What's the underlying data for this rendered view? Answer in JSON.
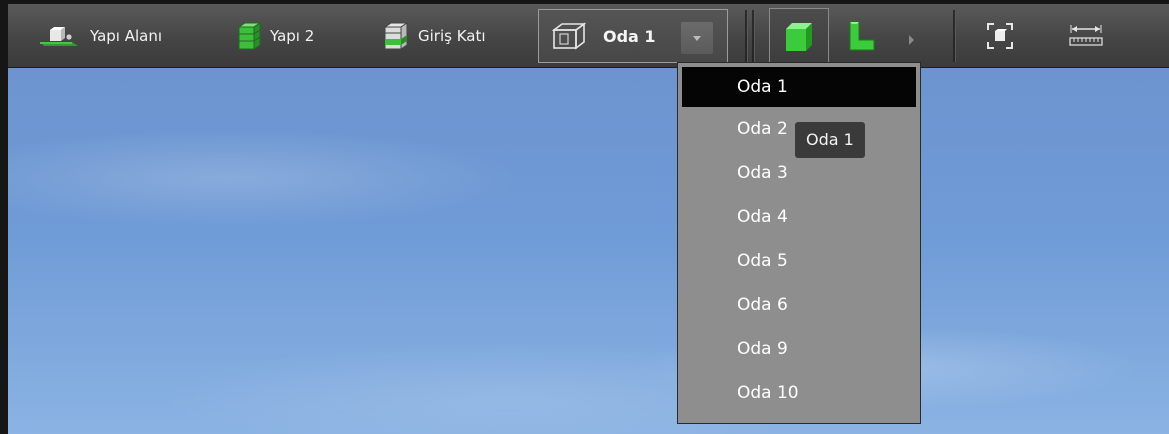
{
  "toolbar": {
    "items": [
      {
        "label": "Yapı Alanı",
        "icon": "site-box-icon"
      },
      {
        "label": "Yapı 2",
        "icon": "building-icon"
      },
      {
        "label": "Giriş Katı",
        "icon": "floor-icon"
      }
    ],
    "room_selector": {
      "value": "Oda 1",
      "icon": "room-icon"
    },
    "tools": [
      {
        "icon": "solid-view-icon"
      },
      {
        "icon": "wall-l-shape-icon"
      },
      {
        "icon": "more-arrow-icon"
      },
      {
        "icon": "fit-view-icon"
      },
      {
        "icon": "measure-ruler-icon"
      }
    ]
  },
  "dropdown": {
    "options": [
      "Oda 1",
      "Oda 2",
      "Oda 3",
      "Oda 4",
      "Oda 5",
      "Oda 6",
      "Oda 9",
      "Oda 10"
    ],
    "selected_index": 0
  },
  "tooltip": {
    "text": "Oda 1"
  },
  "colors": {
    "toolbar_bg": "#4a4a4a",
    "accent_green": "#3fbf3f",
    "dropdown_bg": "#8e8e8e",
    "selected_bg": "#050505",
    "sky": "#6f9bd6"
  }
}
